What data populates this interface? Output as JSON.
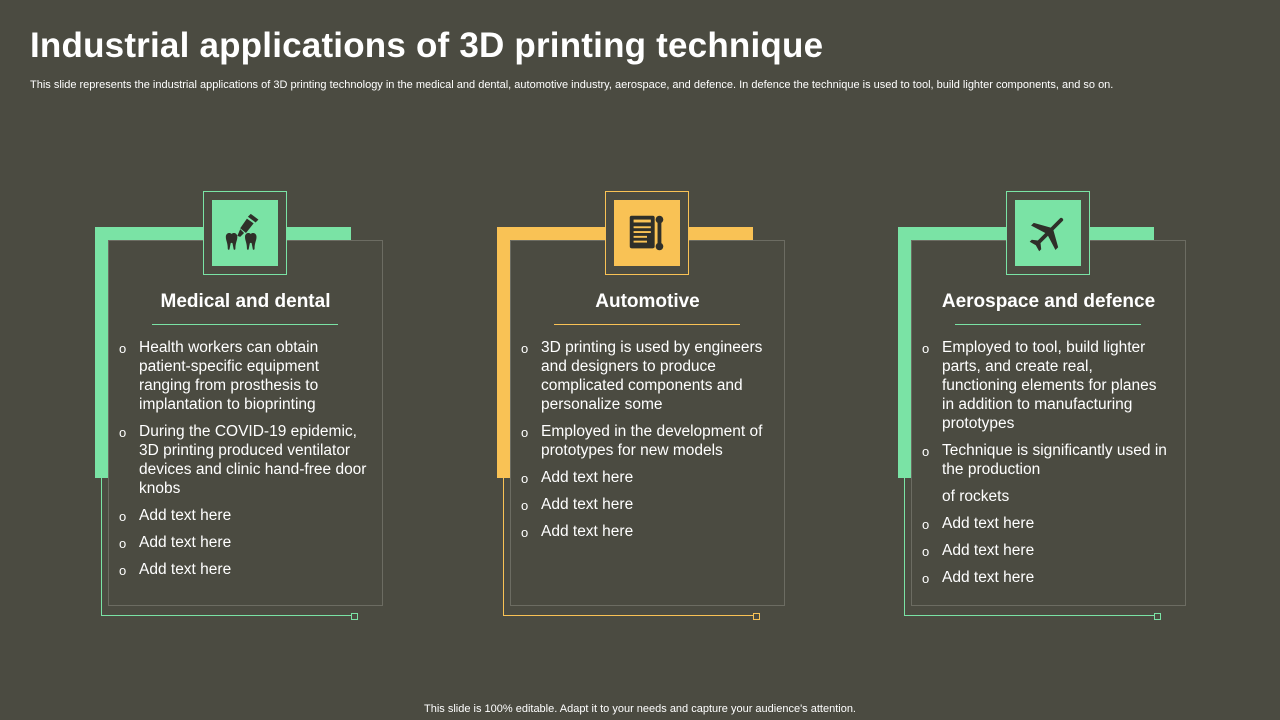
{
  "slide": {
    "title": "Industrial applications of 3D printing technique",
    "subtitle": "This slide represents the industrial applications of 3D printing technology in the medical and dental, automotive industry, aerospace, and defence. In defence the technique is used to tool, build lighter components, and so on.",
    "footer": "This slide is 100% editable. Adapt it to your needs and capture your audience's attention."
  },
  "colors": {
    "background": "#4b4b41",
    "green": "#7ae3a5",
    "yellow": "#f9c255",
    "icon_dark": "#2f2f29"
  },
  "cards": [
    {
      "title": "Medical and dental",
      "icon": "dental-icon",
      "items": [
        "Health workers can obtain patient-specific equipment ranging from prosthesis to implantation to bioprinting",
        "During the COVID-19 epidemic, 3D printing produced ventilator devices and clinic hand-free door knobs",
        "Add text here",
        "Add text here",
        "Add text here"
      ]
    },
    {
      "title": "Automotive",
      "icon": "document-wrench-icon",
      "items": [
        "3D printing is used by engineers and designers to produce complicated components and personalize some",
        "Employed in the development of prototypes for new models",
        "Add text here",
        "Add text here",
        "Add text here"
      ]
    },
    {
      "title": "Aerospace and defence",
      "icon": "airplane-icon",
      "items": [
        "Employed to tool, build lighter parts, and create real, functioning elements for planes in addition to manufacturing prototypes",
        "Technique is significantly used in the production",
        "of rockets",
        "Add text here",
        "Add text here",
        "Add text here"
      ]
    }
  ],
  "bullet_symbol": "o"
}
